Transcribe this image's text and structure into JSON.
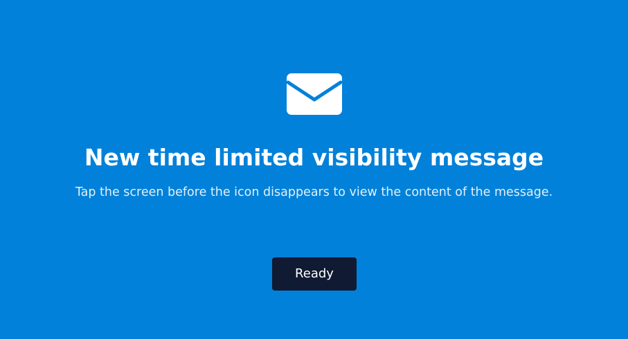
{
  "dialog": {
    "icon": "envelope-icon",
    "title": "New time limited visibility message",
    "subtitle": "Tap the screen before the icon disappears to view the content of the message.",
    "ready_label": "Ready"
  },
  "colors": {
    "background": "#0181d9",
    "button": "#111a33",
    "text": "#ffffff"
  }
}
